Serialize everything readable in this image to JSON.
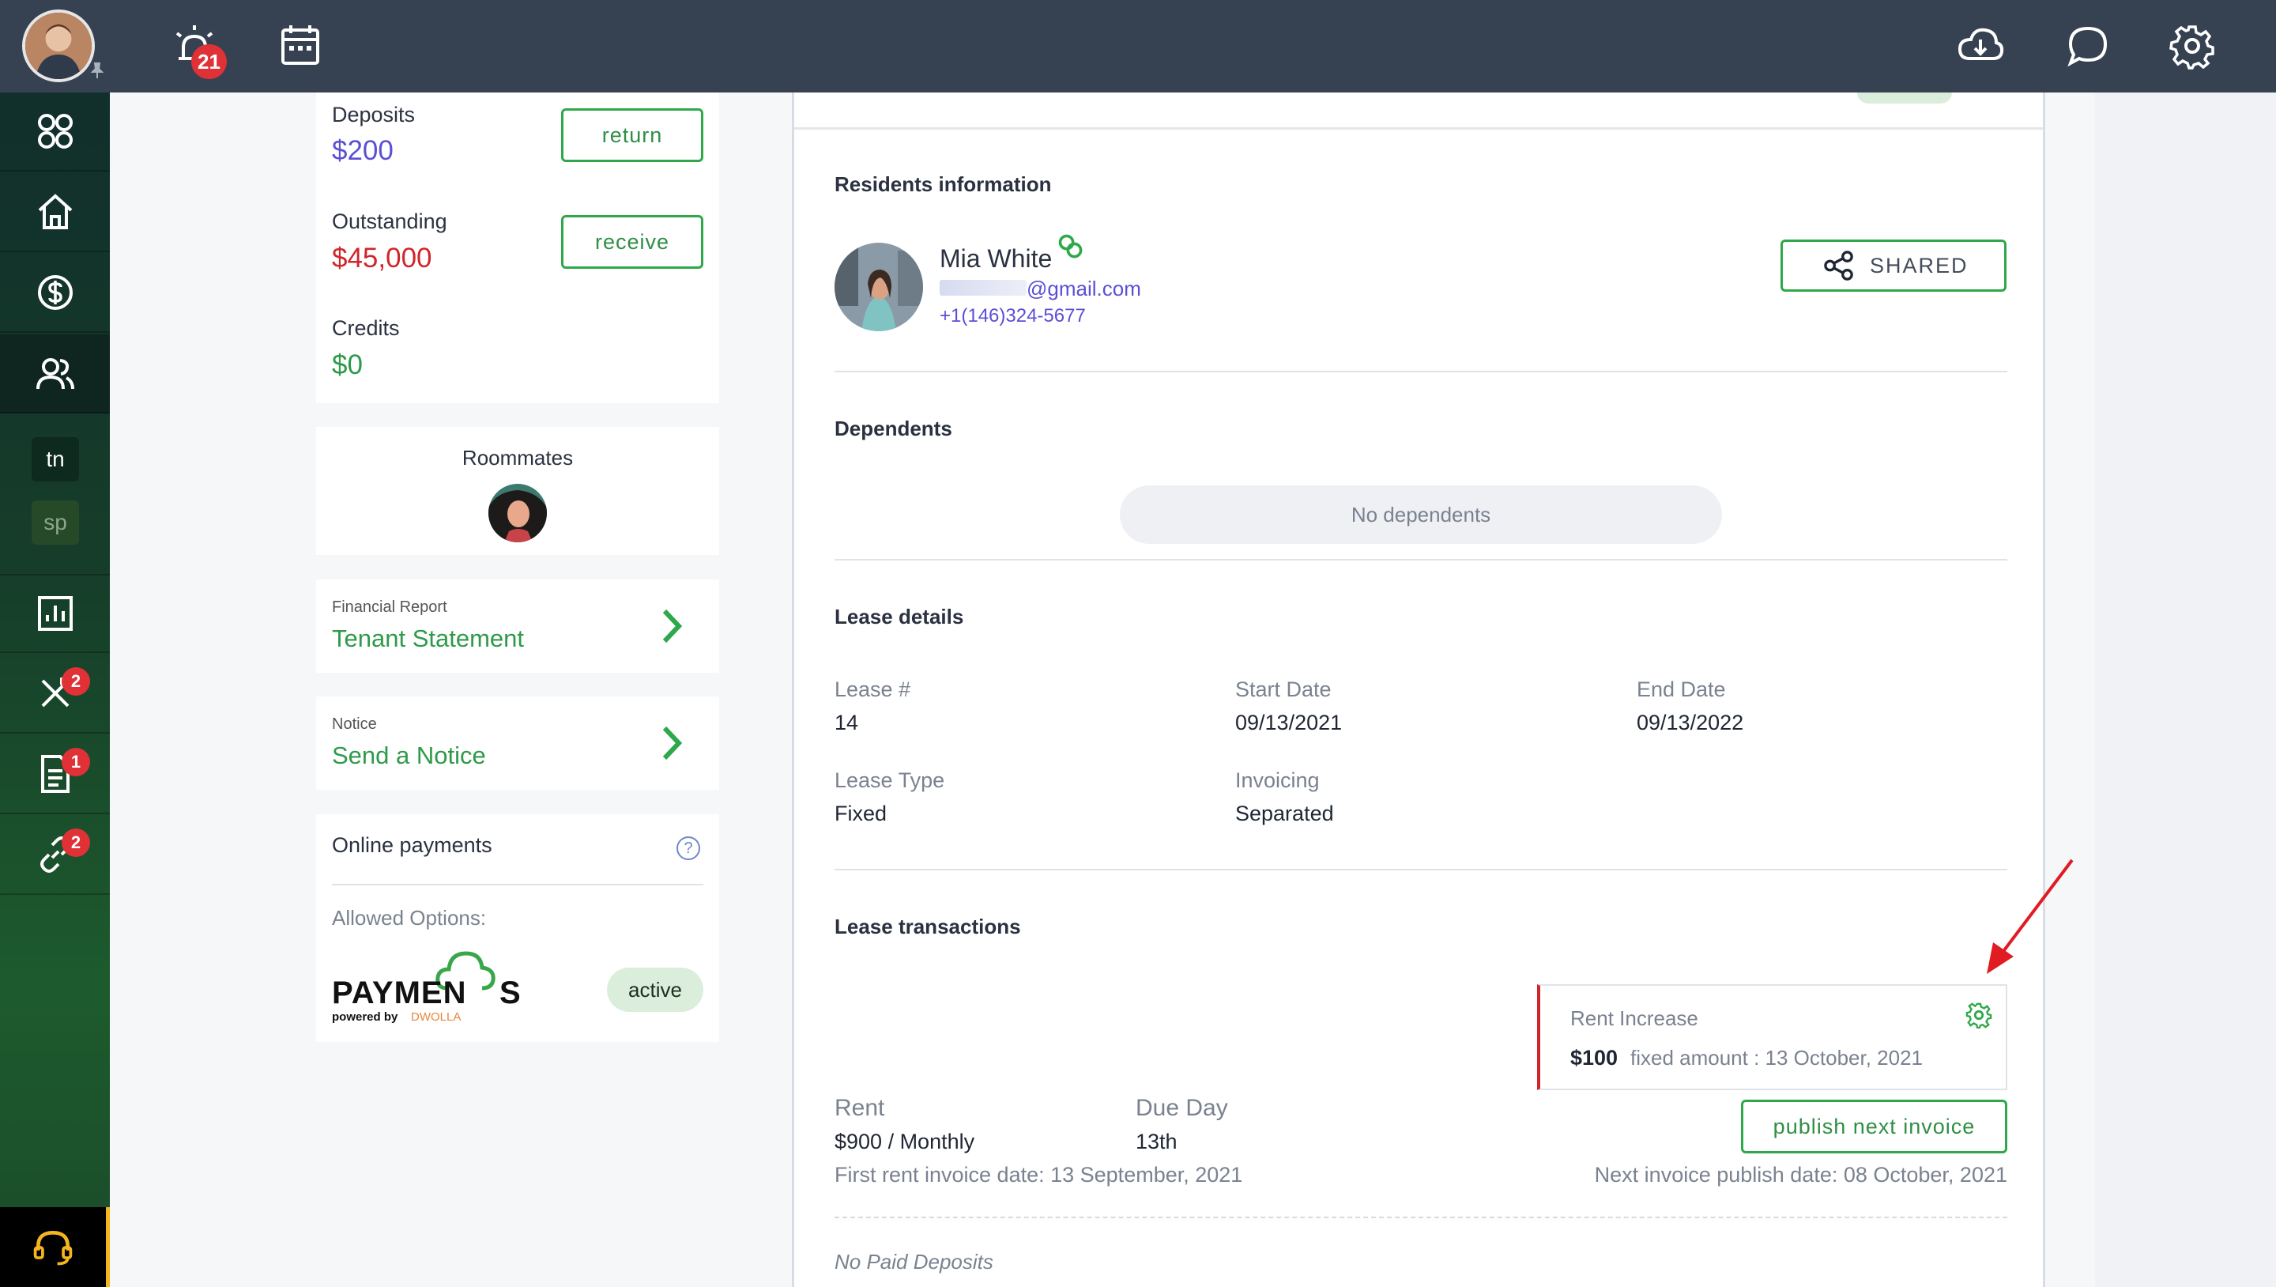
{
  "topbar": {
    "alerts_badge": "21"
  },
  "sidebar": {
    "maintenance_badge": "2",
    "documents_badge": "1",
    "links_badge": "2",
    "properties": [
      {
        "label": "tn",
        "bg": "#0e2a1f",
        "color": "#ffffff"
      },
      {
        "label": "sp",
        "bg": "#264a27",
        "color": "#8ea68f"
      }
    ]
  },
  "balances": {
    "deposits_label": "Deposits",
    "deposits_value": "$200",
    "return_button": "return",
    "outstanding_label": "Outstanding",
    "outstanding_value": "$45,000",
    "receive_button": "receive",
    "credits_label": "Credits",
    "credits_value": "$0"
  },
  "roommates": {
    "title": "Roommates"
  },
  "financial_report": {
    "caption": "Financial Report",
    "link": "Tenant Statement"
  },
  "notice": {
    "caption": "Notice",
    "link": "Send a Notice"
  },
  "online_payments": {
    "title": "Online payments",
    "help": "?",
    "allowed_label": "Allowed Options:",
    "logo_text_left": "PAYMEN",
    "logo_text_right": "S",
    "logo_powered": "powered by",
    "logo_dwolla": "DWOLLA",
    "status": "active"
  },
  "residents": {
    "title": "Residents information",
    "name": "Mia White",
    "email_suffix": "@gmail.com",
    "phone": "+1(146)324-5677",
    "shared_button": "SHARED"
  },
  "dependents": {
    "title": "Dependents",
    "empty": "No dependents"
  },
  "lease": {
    "title": "Lease details",
    "fields": [
      {
        "label": "Lease #",
        "value": "14"
      },
      {
        "label": "Start Date",
        "value": "09/13/2021"
      },
      {
        "label": "End Date",
        "value": "09/13/2022"
      },
      {
        "label": "Lease Type",
        "value": "Fixed"
      },
      {
        "label": "Invoicing",
        "value": "Separated"
      }
    ]
  },
  "transactions": {
    "title": "Lease transactions",
    "rent_increase_label": "Rent Increase",
    "rent_increase_amount": "$100",
    "rent_increase_detail": "fixed amount : 13 October, 2021",
    "rent_label": "Rent",
    "rent_value": "$900 / Monthly",
    "due_label": "Due Day",
    "due_value": "13th",
    "first_invoice": "First rent invoice date: 13 September, 2021",
    "publish_button": "publish next invoice",
    "next_publish": "Next invoice publish date: 08 October, 2021",
    "no_deposits": "No Paid Deposits"
  },
  "colors": {
    "topbar": "#364252",
    "accent_green": "#2ea84a",
    "deposit_blue": "#5b4fd6",
    "outstanding_red": "#d0262b",
    "credits_green": "#2e9a49",
    "badge_red": "#e03136"
  }
}
